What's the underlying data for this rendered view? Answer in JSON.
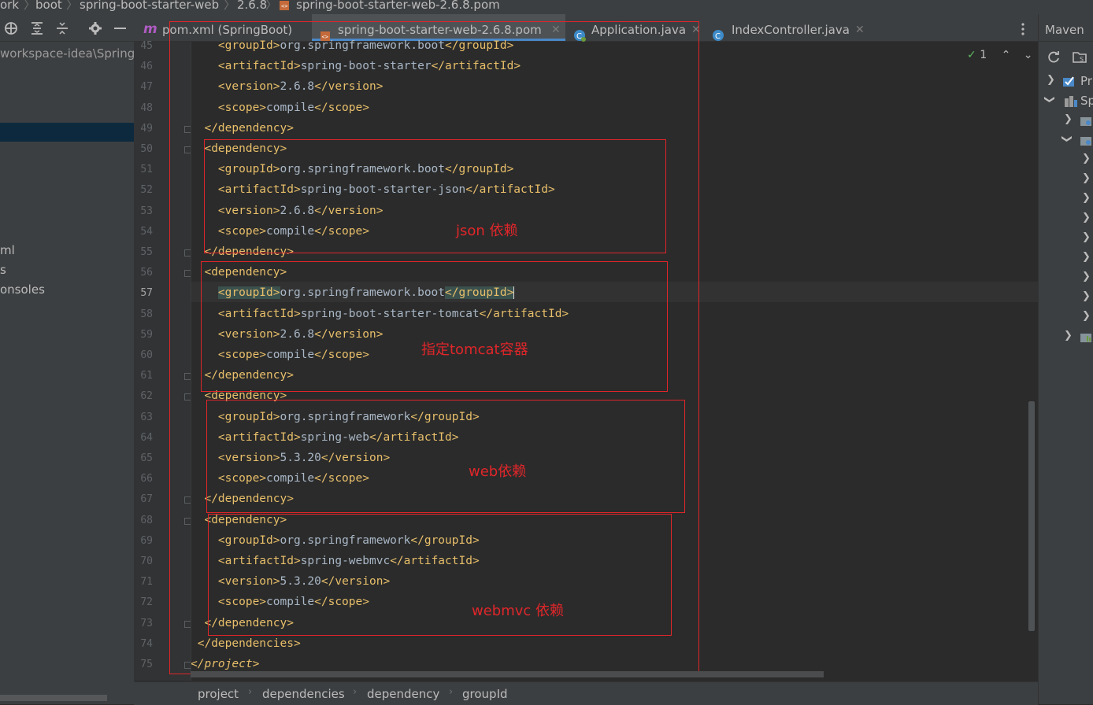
{
  "breadcrumb": {
    "items": [
      "ork",
      "boot",
      "spring-boot-starter-web",
      "2.6.8",
      "spring-boot-starter-web-2.6.8.pom"
    ]
  },
  "left_panel": {
    "path_text": "workspace-idea\\SpringE",
    "item_xml": "ml",
    "item_s": "s",
    "item_consoles": "onsoles"
  },
  "tabs": [
    {
      "label": "pom.xml (SpringBoot)",
      "icon": "maven-icon"
    },
    {
      "label": "spring-boot-starter-web-2.6.8.pom",
      "icon": "pom-file-icon",
      "active": true
    },
    {
      "label": "Application.java",
      "icon": "java-class-icon"
    },
    {
      "label": "IndexController.java",
      "icon": "java-class-icon"
    }
  ],
  "editor": {
    "inspection_count": "1",
    "code_lines": [
      {
        "num": "45",
        "indent": "    ",
        "open": "<groupId>",
        "text": "org.springframework.boot",
        "close": "</groupId>"
      },
      {
        "num": "46",
        "indent": "    ",
        "open": "<artifactId>",
        "text": "spring-boot-starter",
        "close": "</artifactId>"
      },
      {
        "num": "47",
        "indent": "    ",
        "open": "<version>",
        "text": "2.6.8",
        "close": "</version>"
      },
      {
        "num": "48",
        "indent": "    ",
        "open": "<scope>",
        "text": "compile",
        "close": "</scope>"
      },
      {
        "num": "49",
        "indent": "  ",
        "open": "</dependency>",
        "text": "",
        "close": ""
      },
      {
        "num": "50",
        "indent": "  ",
        "open": "<dependency>",
        "text": "",
        "close": ""
      },
      {
        "num": "51",
        "indent": "    ",
        "open": "<groupId>",
        "text": "org.springframework.boot",
        "close": "</groupId>"
      },
      {
        "num": "52",
        "indent": "    ",
        "open": "<artifactId>",
        "text": "spring-boot-starter-json",
        "close": "</artifactId>"
      },
      {
        "num": "53",
        "indent": "    ",
        "open": "<version>",
        "text": "2.6.8",
        "close": "</version>"
      },
      {
        "num": "54",
        "indent": "    ",
        "open": "<scope>",
        "text": "compile",
        "close": "</scope>"
      },
      {
        "num": "55",
        "indent": "  ",
        "open": "</dependency>",
        "text": "",
        "close": ""
      },
      {
        "num": "56",
        "indent": "  ",
        "open": "<dependency>",
        "text": "",
        "close": ""
      },
      {
        "num": "57",
        "indent": "    ",
        "open": "<groupId>",
        "text": "org.springframework.boot",
        "close": "</groupId>"
      },
      {
        "num": "58",
        "indent": "    ",
        "open": "<artifactId>",
        "text": "spring-boot-starter-tomcat",
        "close": "</artifactId>"
      },
      {
        "num": "59",
        "indent": "    ",
        "open": "<version>",
        "text": "2.6.8",
        "close": "</version>"
      },
      {
        "num": "60",
        "indent": "    ",
        "open": "<scope>",
        "text": "compile",
        "close": "</scope>"
      },
      {
        "num": "61",
        "indent": "  ",
        "open": "</dependency>",
        "text": "",
        "close": ""
      },
      {
        "num": "62",
        "indent": "  ",
        "open": "<dependency>",
        "text": "",
        "close": ""
      },
      {
        "num": "63",
        "indent": "    ",
        "open": "<groupId>",
        "text": "org.springframework",
        "close": "</groupId>"
      },
      {
        "num": "64",
        "indent": "    ",
        "open": "<artifactId>",
        "text": "spring-web",
        "close": "</artifactId>"
      },
      {
        "num": "65",
        "indent": "    ",
        "open": "<version>",
        "text": "5.3.20",
        "close": "</version>"
      },
      {
        "num": "66",
        "indent": "    ",
        "open": "<scope>",
        "text": "compile",
        "close": "</scope>"
      },
      {
        "num": "67",
        "indent": "  ",
        "open": "</dependency>",
        "text": "",
        "close": ""
      },
      {
        "num": "68",
        "indent": "  ",
        "open": "<dependency>",
        "text": "",
        "close": ""
      },
      {
        "num": "69",
        "indent": "    ",
        "open": "<groupId>",
        "text": "org.springframework",
        "close": "</groupId>"
      },
      {
        "num": "70",
        "indent": "    ",
        "open": "<artifactId>",
        "text": "spring-webmvc",
        "close": "</artifactId>"
      },
      {
        "num": "71",
        "indent": "    ",
        "open": "<version>",
        "text": "5.3.20",
        "close": "</version>"
      },
      {
        "num": "72",
        "indent": "    ",
        "open": "<scope>",
        "text": "compile",
        "close": "</scope>"
      },
      {
        "num": "73",
        "indent": "  ",
        "open": "</dependency>",
        "text": "",
        "close": ""
      },
      {
        "num": "74",
        "indent": " ",
        "open": "</dependencies>",
        "text": "",
        "close": ""
      },
      {
        "num": "75",
        "indent": "",
        "open": "</project>",
        "text": "",
        "close": ""
      }
    ]
  },
  "annotations": {
    "json": "json 依赖",
    "tomcat": "指定tomcat容器",
    "web": "web依赖",
    "webmvc": "webmvc 依赖"
  },
  "maven_panel": {
    "title": "Maven",
    "tree_items": [
      "Pr",
      "Sp"
    ]
  },
  "bottom_breadcrumb": [
    "project",
    "dependencies",
    "dependency",
    "groupId"
  ],
  "colors": {
    "annotation_red": "#e0262a",
    "xml_tag": "#e8bf6a",
    "xml_text": "#a9b7c6"
  }
}
